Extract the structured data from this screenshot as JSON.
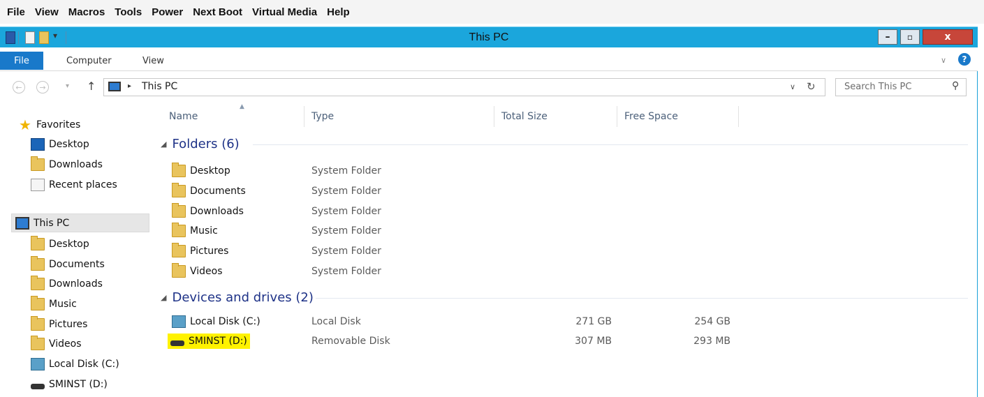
{
  "kvm_menu": [
    "File",
    "View",
    "Macros",
    "Tools",
    "Power",
    "Next Boot",
    "Virtual Media",
    "Help"
  ],
  "window": {
    "title": "This PC",
    "controls": {
      "minimize": "–",
      "restore": "▫",
      "close": "x"
    }
  },
  "ribbon": {
    "file_tab": "File",
    "tabs": [
      "Computer",
      "View"
    ],
    "help": "?"
  },
  "address": {
    "path": "This PC",
    "search_placeholder": "Search This PC"
  },
  "nav": {
    "favorites": {
      "label": "Favorites",
      "items": [
        {
          "label": "Desktop",
          "icon": "desktop-icon"
        },
        {
          "label": "Downloads",
          "icon": "downloads-folder-icon"
        },
        {
          "label": "Recent places",
          "icon": "recent-places-icon"
        }
      ]
    },
    "this_pc": {
      "label": "This PC",
      "items": [
        {
          "label": "Desktop",
          "icon": "desktop-folder-icon"
        },
        {
          "label": "Documents",
          "icon": "documents-folder-icon"
        },
        {
          "label": "Downloads",
          "icon": "downloads-folder-icon"
        },
        {
          "label": "Music",
          "icon": "music-folder-icon"
        },
        {
          "label": "Pictures",
          "icon": "pictures-folder-icon"
        },
        {
          "label": "Videos",
          "icon": "videos-folder-icon"
        },
        {
          "label": "Local Disk (C:)",
          "icon": "local-disk-icon"
        },
        {
          "label": "SMINST (D:)",
          "icon": "removable-disk-icon"
        }
      ]
    }
  },
  "columns": [
    "Name",
    "Type",
    "Total Size",
    "Free Space"
  ],
  "groups": {
    "folders": {
      "label": "Folders (6)",
      "items": [
        {
          "name": "Desktop",
          "type": "System Folder"
        },
        {
          "name": "Documents",
          "type": "System Folder"
        },
        {
          "name": "Downloads",
          "type": "System Folder"
        },
        {
          "name": "Music",
          "type": "System Folder"
        },
        {
          "name": "Pictures",
          "type": "System Folder"
        },
        {
          "name": "Videos",
          "type": "System Folder"
        }
      ]
    },
    "drives": {
      "label": "Devices and drives (2)",
      "items": [
        {
          "name": "Local Disk (C:)",
          "type": "Local Disk",
          "total": "271 GB",
          "free": "254 GB"
        },
        {
          "name": "SMINST (D:)",
          "type": "Removable Disk",
          "total": "307 MB",
          "free": "293 MB",
          "highlight": "#fff200"
        }
      ]
    }
  },
  "colors": {
    "titlebar": "#1ba6dc",
    "file_tab": "#1979ca",
    "close_button": "#c7463a",
    "group_heading": "#1e3287"
  }
}
